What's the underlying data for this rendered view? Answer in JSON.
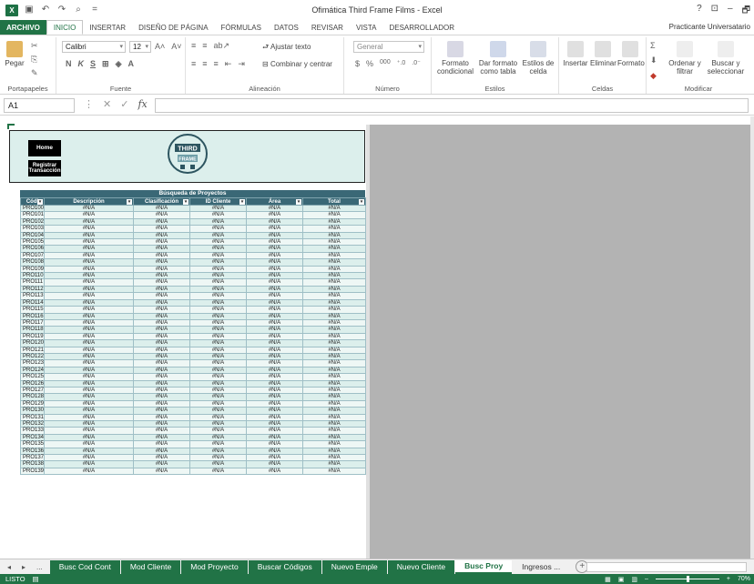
{
  "window": {
    "title": "Ofimática Third Frame Films - Excel",
    "controls": [
      "?",
      "⊡",
      "–",
      "🗗",
      "✕"
    ]
  },
  "ribbon_tabs": [
    "ARCHIVO",
    "INICIO",
    "INSERTAR",
    "DISEÑO DE PÁGINA",
    "FÓRMULAS",
    "DATOS",
    "REVISAR",
    "VISTA",
    "DESARROLLADOR"
  ],
  "user": "Practicante Universatario",
  "ribbon": {
    "clipboard": {
      "paste": "Pegar",
      "label": "Portapapeles"
    },
    "font": {
      "name": "Calibri",
      "size": "12",
      "label": "Fuente",
      "buttons": [
        "N",
        "K",
        "S"
      ]
    },
    "alignment": {
      "wrap": "Ajustar texto",
      "merge": "Combinar y centrar",
      "label": "Alineación"
    },
    "number": {
      "format": "General",
      "label": "Número",
      "currency": "$",
      "percent": "%",
      "thousands": "000"
    },
    "styles": {
      "conditional": "Formato condicional",
      "table": "Dar formato como tabla",
      "cell": "Estilos de celda",
      "label": "Estilos"
    },
    "cells": {
      "insert": "Insertar",
      "delete": "Eliminar",
      "format": "Formato",
      "label": "Celdas"
    },
    "editing": {
      "sort": "Ordenar y filtrar",
      "find": "Buscar y seleccionar",
      "label": "Modificar"
    }
  },
  "formula_bar": {
    "name_box": "A1",
    "fx": "fx",
    "value": ""
  },
  "panel": {
    "home_btn": "Home",
    "register_btn": "Registrar Transacción",
    "logo_text_top": "THIRD",
    "logo_text_bottom": "FRAME"
  },
  "table": {
    "caption": "Búsqueda de Proyectos",
    "headers": [
      "Códi",
      "Descripción",
      "Clasificación",
      "ID Cliente",
      "Área",
      "Total"
    ],
    "codes": [
      "PRO100",
      "PRO101",
      "PRO102",
      "PRO103",
      "PRO104",
      "PRO105",
      "PRO106",
      "PRO107",
      "PRO108",
      "PRO109",
      "PRO110",
      "PRO111",
      "PRO112",
      "PRO113",
      "PRO114",
      "PRO115",
      "PRO116",
      "PRO117",
      "PRO118",
      "PRO119",
      "PRO120",
      "PRO121",
      "PRO122",
      "PRO123",
      "PRO124",
      "PRO125",
      "PRO126",
      "PRO127",
      "PRO128",
      "PRO129",
      "PRO130",
      "PRO131",
      "PRO132",
      "PRO133",
      "PRO134",
      "PRO135",
      "PRO136",
      "PRO137",
      "PRO138",
      "PRO139"
    ],
    "na": "#N/A"
  },
  "sheet_tabs": {
    "ellipsis_left": "...",
    "tabs": [
      "Busc Cod Cont",
      "Mod Cliente",
      "Mod Proyecto",
      "Buscar Códigos",
      "Nuevo Emple",
      "Nuevo Cliente",
      "Busc Proy",
      "Ingresos ..."
    ],
    "active": "Busc Proy",
    "add": "+"
  },
  "status": {
    "mode": "LISTO",
    "zoom": "70%"
  }
}
